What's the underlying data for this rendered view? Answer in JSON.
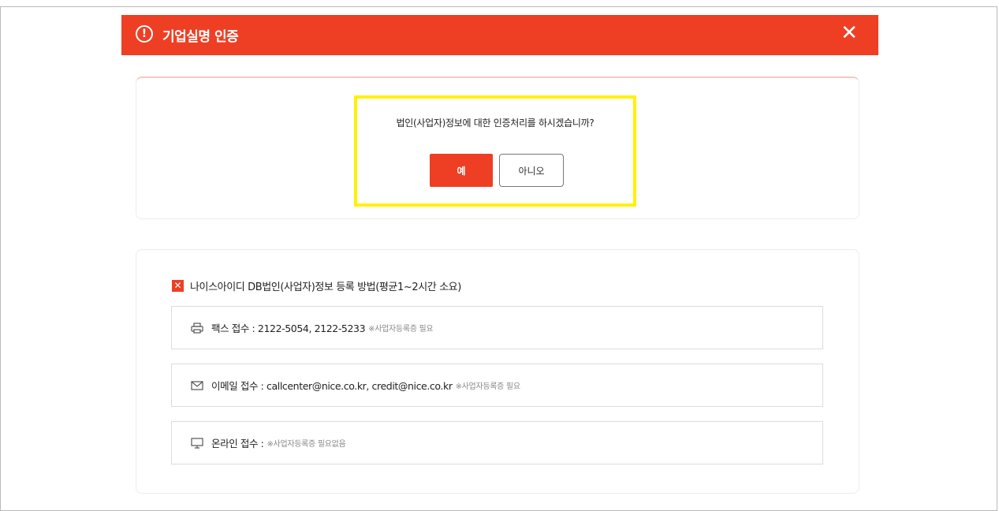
{
  "header": {
    "alert_glyph": "!",
    "title": "기업실명 인증",
    "close_glyph": "✕",
    "background_color": "#ee3f24"
  },
  "confirm": {
    "question": "법인(사업자)정보에 대한 인증처리를 하시겠습니까?",
    "yes_label": "예",
    "no_label": "아니오",
    "highlight_color": "#fff200"
  },
  "registration": {
    "checkbox_glyph": "✕",
    "title": "나이스아이디 DB법인(사업자)정보 등록 방법(평균1~2시간 소요)",
    "methods": [
      {
        "icon": "printer-icon",
        "label": "팩스 접수 : 2122-5054, 2122-5233",
        "note": "※사업자등록증 필요"
      },
      {
        "icon": "mail-icon",
        "label": "이메일 접수 : callcenter@nice.co.kr, credit@nice.co.kr",
        "note": "※사업자등록증 필요"
      },
      {
        "icon": "monitor-icon",
        "label": "온라인 접수 :",
        "note": "※사업자등록증 필요없음"
      }
    ]
  }
}
